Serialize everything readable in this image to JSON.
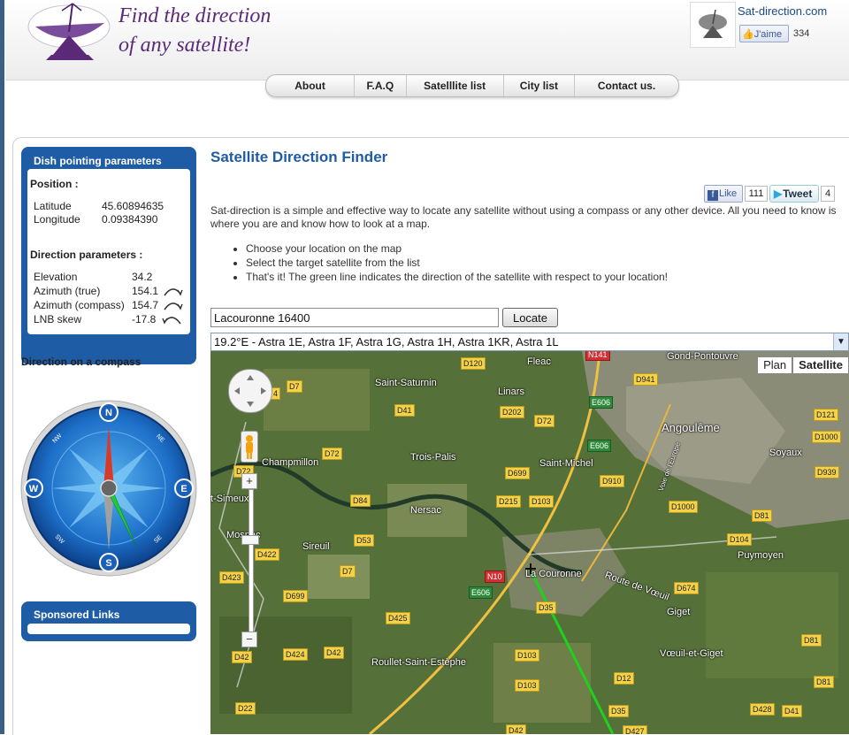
{
  "header": {
    "tagline_line1": "Find the direction",
    "tagline_line2": "of any satellite!",
    "fb_title": "Sat-direction.com",
    "fb_like_label": "J'aime",
    "fb_like_count": "334"
  },
  "nav": {
    "items": [
      {
        "label": "About"
      },
      {
        "label": "F.A.Q"
      },
      {
        "label": "Satelllite list"
      },
      {
        "label": "City list"
      },
      {
        "label": "Contact us."
      }
    ]
  },
  "dish_panel": {
    "title": "Dish pointing parameters",
    "position_heading": "Position :",
    "latitude_label": "Latitude",
    "latitude_value": "45.60894635",
    "longitude_label": "Longitude",
    "longitude_value": "0.09384390",
    "direction_heading": "Direction parameters :",
    "elevation_label": "Elevation",
    "elevation_value": "34.2",
    "azimuth_true_label": "Azimuth (true)",
    "azimuth_true_value": "154.1",
    "azimuth_compass_label": "Azimuth (compass)",
    "azimuth_compass_value": "154.7",
    "lnb_skew_label": "LNB skew",
    "lnb_skew_value": "-17.8"
  },
  "compass": {
    "title": "Direction on a compass",
    "n": "N",
    "s": "S",
    "e": "E",
    "w": "W",
    "ne": "NE",
    "nw": "NW",
    "se": "SE",
    "sw": "SW",
    "heading_deg": 154.7
  },
  "sponsored": {
    "title": "Sponsored Links"
  },
  "main": {
    "title": "Satellite Direction Finder",
    "social": {
      "fb_like": "Like",
      "fb_count": "111",
      "tweet": "Tweet",
      "tweet_count": "4"
    },
    "intro": "Sat-direction is a simple and effective way to locate any satellite without using a compass or any other device. All you need to know is where you are and know how to look at a map.",
    "bullets": [
      "Choose your location on the map",
      "Select the target satellite from the list",
      "That's it! The green line indicates the direction of the satellite with respect to your location!"
    ]
  },
  "locate": {
    "input_value": "Lacouronne 16400",
    "button_label": "Locate"
  },
  "satellite_select": {
    "selected": "19.2°E - Astra 1E, Astra 1F, Astra 1G, Astra 1H, Astra 1KR, Astra 1L"
  },
  "map": {
    "type_plan": "Plan",
    "type_satellite": "Satellite",
    "towns": {
      "fleac": "Fleac",
      "gond": "Gond-Pontouvre",
      "saint_saturnin": "Saint-Saturnin",
      "linars": "Linars",
      "angouleme": "Angoulême",
      "soyaux": "Soyaux",
      "champmillon": "Champmillon",
      "trois_palis": "Trois-Palis",
      "saint_michel": "Saint-Michel",
      "simeux": "t-Simeux",
      "nersac": "Nersac",
      "mosnac": "Mosnac",
      "sireuil": "Sireuil",
      "puymoyen": "Puymoyen",
      "la_couronne": "La Couronne",
      "route": "Route de Vœuil",
      "giget": "Giget",
      "voeuil": "Vœuil-et-Giget",
      "roullet": "Roullet-Saint-Estèphe",
      "voie": "Voie de l'Europe"
    },
    "roads": {
      "d120": "D120",
      "n141": "N141",
      "d941": "D941",
      "d7a": "D7",
      "d4": "4",
      "d41a": "D41",
      "d202": "D202",
      "d72a": "D72",
      "e606a": "E606",
      "d121": "D121",
      "d1000a": "D1000",
      "e606b": "E606",
      "d72b": "D72",
      "d72c": "D72",
      "d699a": "D699",
      "d910": "D910",
      "d939": "D939",
      "d84": "D84",
      "d215": "D215",
      "d103a": "D103",
      "d1000b": "D1000",
      "d81a": "D81",
      "d53": "D53",
      "d104": "D104",
      "d422": "D422",
      "d7b": "D7",
      "d423": "D423",
      "n10": "N10",
      "e606c": "E606",
      "d674": "D674",
      "d699b": "D699",
      "d35a": "D35",
      "d425": "D425",
      "d81b": "D81",
      "d42a": "D42",
      "d424": "D424",
      "d42b": "D42",
      "d103b": "D103",
      "d12": "D12",
      "d103c": "D103",
      "d81c": "D81",
      "d22": "D22",
      "d35b": "D35",
      "d428": "D428",
      "d41b": "D41",
      "d42c": "D42",
      "d427": "D427"
    }
  }
}
